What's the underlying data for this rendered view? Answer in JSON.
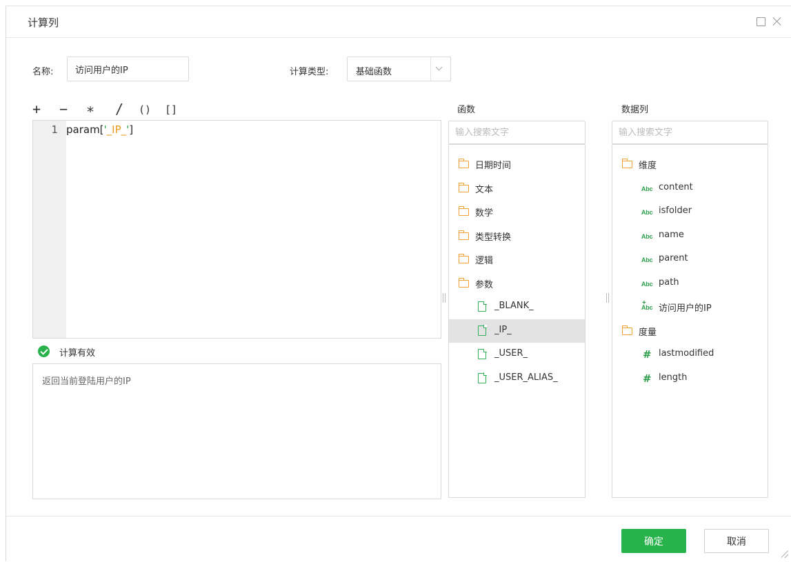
{
  "dialog": {
    "title": "计算列",
    "maximize_icon": "maximize-icon",
    "close_icon": "close-icon"
  },
  "form": {
    "name_label": "名称:",
    "name_value": "访问用户的IP",
    "type_label": "计算类型:",
    "type_value": "基础函数"
  },
  "operators": [
    "+",
    "−",
    "∗",
    "/",
    "()",
    "[]"
  ],
  "editor": {
    "line_number": "1",
    "code_prefix": "param[",
    "code_quote_open": "'",
    "code_string": "_IP_",
    "code_quote_close": "'",
    "code_suffix": "]"
  },
  "validation": {
    "status_text": "计算有效",
    "description": "返回当前登陆用户的IP"
  },
  "functions_panel": {
    "title": "函数",
    "search_placeholder": "输入搜索文字",
    "items": [
      {
        "label": "日期时间",
        "type": "folder",
        "expanded": false
      },
      {
        "label": "文本",
        "type": "folder",
        "expanded": false
      },
      {
        "label": "数学",
        "type": "folder",
        "expanded": false
      },
      {
        "label": "类型转换",
        "type": "folder",
        "expanded": false
      },
      {
        "label": "逻辑",
        "type": "folder",
        "expanded": false
      },
      {
        "label": "参数",
        "type": "folder",
        "expanded": true
      },
      {
        "label": "_BLANK_",
        "type": "file",
        "selected": false
      },
      {
        "label": "_IP_",
        "type": "file",
        "selected": true
      },
      {
        "label": "_USER_",
        "type": "file",
        "selected": false
      },
      {
        "label": "_USER_ALIAS_",
        "type": "file",
        "selected": false
      }
    ]
  },
  "columns_panel": {
    "title": "数据列",
    "search_placeholder": "输入搜索文字",
    "items": [
      {
        "label": "维度",
        "type": "folder"
      },
      {
        "label": "content",
        "type": "abc",
        "abc": "Abc"
      },
      {
        "label": "isfolder",
        "type": "abc",
        "abc": "Abc"
      },
      {
        "label": "name",
        "type": "abc",
        "abc": "Abc"
      },
      {
        "label": "parent",
        "type": "abc",
        "abc": "Abc"
      },
      {
        "label": "path",
        "type": "abc",
        "abc": "Abc"
      },
      {
        "label": "访问用户的IP",
        "type": "abc-calc",
        "abc": "Abc"
      },
      {
        "label": "度量",
        "type": "folder"
      },
      {
        "label": "lastmodified",
        "type": "number",
        "symbol": "#"
      },
      {
        "label": "length",
        "type": "number",
        "symbol": "#"
      }
    ]
  },
  "footer": {
    "ok_label": "确定",
    "cancel_label": "取消"
  },
  "colors": {
    "accent": "#27b24c",
    "folder": "#f0a030",
    "string": "#e89a19",
    "selected_row": "#e3e3e3"
  }
}
